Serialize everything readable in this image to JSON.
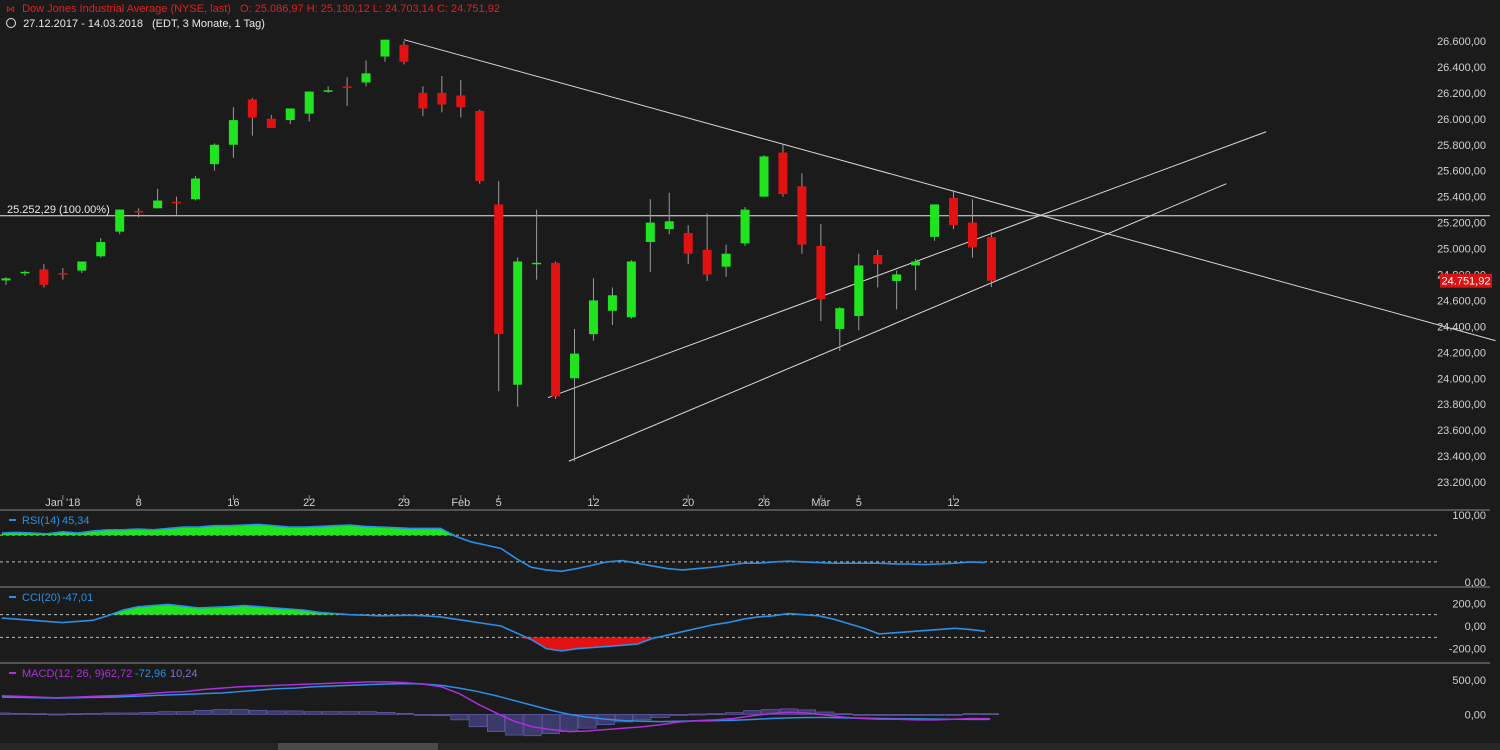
{
  "header": {
    "title": "Dow Jones Industrial Average (NYSE, last)",
    "ohlc": "O: 25.086,97  H: 25.130,12  L: 24.703,14  C: 24.751,92",
    "range": "27.12.2017 - 14.03.2018",
    "info": "(EDT, 3 Monate, 1 Tag)"
  },
  "colors": {
    "up": "#1fe41f",
    "down": "#e31212",
    "rsi": "#2b8fe8",
    "macd": "#b02ee0",
    "signal": "#2b8fe8",
    "bg": "#1c1b1b",
    "grid": "#4a4a4a"
  },
  "chart_data": [
    {
      "type": "candlestick",
      "title": "Dow Jones Industrial Average (NYSE, last)",
      "x_tick_labels": [
        "Jan '18",
        "8",
        "16",
        "22",
        "29",
        "Feb",
        "5",
        "12",
        "20",
        "26",
        "Mär",
        "5",
        "12"
      ],
      "y_tick_labels": [
        "26.600,00",
        "26.400,00",
        "26.200,00",
        "26.000,00",
        "25.800,00",
        "25.600,00",
        "25.400,00",
        "25.200,00",
        "25.000,00",
        "24.800,00",
        "24.600,00",
        "24.400,00",
        "24.200,00",
        "24.000,00",
        "23.800,00",
        "23.600,00",
        "23.400,00",
        "23.200,00"
      ],
      "ylim": [
        23100,
        26700
      ],
      "reference_line": {
        "value": 25252.29,
        "label": "25.252,29 (100.00%)"
      },
      "last_price_label": "24.751,92",
      "candles": [
        {
          "o": 24754,
          "h": 24780,
          "l": 24720,
          "c": 24770
        },
        {
          "o": 24810,
          "h": 24830,
          "l": 24790,
          "c": 24820
        },
        {
          "o": 24840,
          "h": 24880,
          "l": 24700,
          "c": 24720
        },
        {
          "o": 24810,
          "h": 24850,
          "l": 24760,
          "c": 24800
        },
        {
          "o": 24830,
          "h": 24900,
          "l": 24810,
          "c": 24900
        },
        {
          "o": 24940,
          "h": 25080,
          "l": 24930,
          "c": 25050
        },
        {
          "o": 25130,
          "h": 25300,
          "l": 25110,
          "c": 25300
        },
        {
          "o": 25290,
          "h": 25310,
          "l": 25240,
          "c": 25280
        },
        {
          "o": 25310,
          "h": 25460,
          "l": 25310,
          "c": 25370
        },
        {
          "o": 25360,
          "h": 25400,
          "l": 25260,
          "c": 25350
        },
        {
          "o": 25380,
          "h": 25560,
          "l": 25370,
          "c": 25540
        },
        {
          "o": 25650,
          "h": 25810,
          "l": 25600,
          "c": 25800
        },
        {
          "o": 25800,
          "h": 26090,
          "l": 25700,
          "c": 25990
        },
        {
          "o": 26150,
          "h": 26160,
          "l": 25870,
          "c": 26010
        },
        {
          "o": 26000,
          "h": 26030,
          "l": 25930,
          "c": 25930
        },
        {
          "o": 25990,
          "h": 26080,
          "l": 25960,
          "c": 26080
        },
        {
          "o": 26040,
          "h": 26210,
          "l": 25980,
          "c": 26210
        },
        {
          "o": 26220,
          "h": 26250,
          "l": 26200,
          "c": 26220
        },
        {
          "o": 26250,
          "h": 26320,
          "l": 26100,
          "c": 26240
        },
        {
          "o": 26280,
          "h": 26450,
          "l": 26250,
          "c": 26350
        },
        {
          "o": 26480,
          "h": 26610,
          "l": 26440,
          "c": 26610
        },
        {
          "o": 26570,
          "h": 26600,
          "l": 26420,
          "c": 26440
        },
        {
          "o": 26200,
          "h": 26250,
          "l": 26020,
          "c": 26080
        },
        {
          "o": 26200,
          "h": 26330,
          "l": 26050,
          "c": 26110
        },
        {
          "o": 26180,
          "h": 26300,
          "l": 26010,
          "c": 26090
        },
        {
          "o": 26060,
          "h": 26070,
          "l": 25500,
          "c": 25520
        },
        {
          "o": 25340,
          "h": 25520,
          "l": 23900,
          "c": 24340
        },
        {
          "o": 23950,
          "h": 24930,
          "l": 23780,
          "c": 24900
        },
        {
          "o": 24890,
          "h": 25300,
          "l": 24760,
          "c": 24890
        },
        {
          "o": 24890,
          "h": 24900,
          "l": 23840,
          "c": 23860
        },
        {
          "o": 24000,
          "h": 24380,
          "l": 23360,
          "c": 24190
        },
        {
          "o": 24340,
          "h": 24770,
          "l": 24290,
          "c": 24600
        },
        {
          "o": 24520,
          "h": 24700,
          "l": 24410,
          "c": 24640
        },
        {
          "o": 24470,
          "h": 24910,
          "l": 24460,
          "c": 24900
        },
        {
          "o": 25050,
          "h": 25380,
          "l": 24820,
          "c": 25200
        },
        {
          "o": 25150,
          "h": 25430,
          "l": 25110,
          "c": 25210
        },
        {
          "o": 25120,
          "h": 25180,
          "l": 24880,
          "c": 24960
        },
        {
          "o": 24990,
          "h": 25270,
          "l": 24750,
          "c": 24800
        },
        {
          "o": 24860,
          "h": 25030,
          "l": 24780,
          "c": 24960
        },
        {
          "o": 25040,
          "h": 25320,
          "l": 25020,
          "c": 25300
        },
        {
          "o": 25400,
          "h": 25720,
          "l": 25400,
          "c": 25710
        },
        {
          "o": 25740,
          "h": 25800,
          "l": 25400,
          "c": 25420
        },
        {
          "o": 25480,
          "h": 25580,
          "l": 24960,
          "c": 25030
        },
        {
          "o": 25020,
          "h": 25190,
          "l": 24440,
          "c": 24610
        },
        {
          "o": 24380,
          "h": 24550,
          "l": 24210,
          "c": 24540
        },
        {
          "o": 24480,
          "h": 24960,
          "l": 24370,
          "c": 24870
        },
        {
          "o": 24950,
          "h": 24990,
          "l": 24700,
          "c": 24880
        },
        {
          "o": 24750,
          "h": 24830,
          "l": 24530,
          "c": 24800
        },
        {
          "o": 24870,
          "h": 24920,
          "l": 24680,
          "c": 24900
        },
        {
          "o": 25090,
          "h": 25340,
          "l": 25060,
          "c": 25340
        },
        {
          "o": 25390,
          "h": 25450,
          "l": 25150,
          "c": 25180
        },
        {
          "o": 25200,
          "h": 25380,
          "l": 24930,
          "c": 25010
        },
        {
          "o": 25087,
          "h": 25130,
          "l": 24703,
          "c": 24752
        }
      ]
    },
    {
      "type": "area",
      "series": [
        {
          "name": "RSI(14)",
          "label": "RSI(14)",
          "value_label": "45,34"
        }
      ],
      "y_tick_labels": [
        "100,00",
        "0,00"
      ],
      "ylim": [
        0,
        100
      ],
      "levels": [
        70,
        30
      ],
      "values": [
        73,
        74,
        73,
        72,
        75,
        73,
        76,
        78,
        78,
        79,
        78,
        80,
        82,
        82,
        84,
        84,
        85,
        86,
        84,
        82,
        82,
        83,
        84,
        85,
        83,
        82,
        81,
        80,
        80,
        80,
        68,
        60,
        55,
        50,
        35,
        22,
        18,
        16,
        20,
        25,
        30,
        32,
        28,
        24,
        20,
        18,
        20,
        22,
        25,
        28,
        28,
        30,
        31,
        30,
        29,
        28,
        28,
        28,
        28,
        27,
        27,
        26,
        27,
        28,
        30,
        29
      ]
    },
    {
      "type": "area",
      "series": [
        {
          "name": "CCI(20)",
          "label": "CCI(20)",
          "value_label": "-47,01"
        }
      ],
      "y_tick_labels": [
        "200,00",
        "0,00",
        "-200,00"
      ],
      "ylim": [
        -300,
        300
      ],
      "levels": [
        100,
        -100
      ],
      "values": [
        70,
        60,
        50,
        40,
        30,
        40,
        50,
        90,
        140,
        170,
        180,
        190,
        175,
        160,
        165,
        170,
        180,
        170,
        160,
        150,
        140,
        120,
        110,
        100,
        95,
        90,
        92,
        95,
        90,
        80,
        60,
        40,
        20,
        0,
        -60,
        -120,
        -200,
        -220,
        -200,
        -190,
        -180,
        -170,
        -160,
        -110,
        -80,
        -50,
        -20,
        10,
        30,
        60,
        80,
        90,
        110,
        100,
        90,
        60,
        20,
        -20,
        -70,
        -60,
        -50,
        -40,
        -30,
        -20,
        -30,
        -47
      ]
    },
    {
      "type": "line",
      "series": [
        {
          "name": "MACD(12, 26, 9)",
          "label": "MACD(12, 26, 9)",
          "value_label": "-62,72"
        },
        {
          "name": "Signal",
          "value_label": "-72,96"
        },
        {
          "name": "Histogram",
          "value_label": "10,24"
        }
      ],
      "y_tick_labels": [
        "500,00",
        "0,00"
      ],
      "ylim": [
        -400,
        700
      ],
      "macd": [
        270,
        260,
        250,
        240,
        250,
        260,
        270,
        280,
        300,
        320,
        330,
        360,
        380,
        400,
        410,
        420,
        430,
        440,
        450,
        460,
        470,
        470,
        460,
        440,
        400,
        300,
        150,
        20,
        -100,
        -180,
        -220,
        -250,
        -240,
        -220,
        -200,
        -180,
        -150,
        -110,
        -90,
        -80,
        -60,
        -20,
        10,
        30,
        20,
        -10,
        -40,
        -60,
        -70,
        -70,
        -80,
        -80,
        -70,
        -60,
        -63
      ],
      "signal": [
        250,
        245,
        240,
        235,
        240,
        245,
        250,
        260,
        270,
        280,
        290,
        300,
        310,
        330,
        350,
        370,
        380,
        400,
        410,
        420,
        430,
        440,
        445,
        440,
        420,
        380,
        330,
        270,
        200,
        130,
        60,
        0,
        -40,
        -70,
        -90,
        -100,
        -105,
        -100,
        -95,
        -90,
        -85,
        -75,
        -60,
        -50,
        -45,
        -45,
        -50,
        -55,
        -60,
        -63,
        -66,
        -69,
        -71,
        -72,
        -73
      ],
      "histogram": [
        20,
        15,
        10,
        5,
        10,
        15,
        20,
        20,
        30,
        40,
        40,
        60,
        70,
        70,
        60,
        50,
        50,
        40,
        40,
        40,
        40,
        30,
        15,
        0,
        -20,
        -80,
        -180,
        -250,
        -300,
        -310,
        -280,
        -250,
        -200,
        -150,
        -110,
        -80,
        -45,
        -10,
        5,
        10,
        25,
        55,
        70,
        80,
        65,
        35,
        10,
        -5,
        -10,
        -7,
        -14,
        -11,
        1,
        12,
        10
      ]
    }
  ]
}
